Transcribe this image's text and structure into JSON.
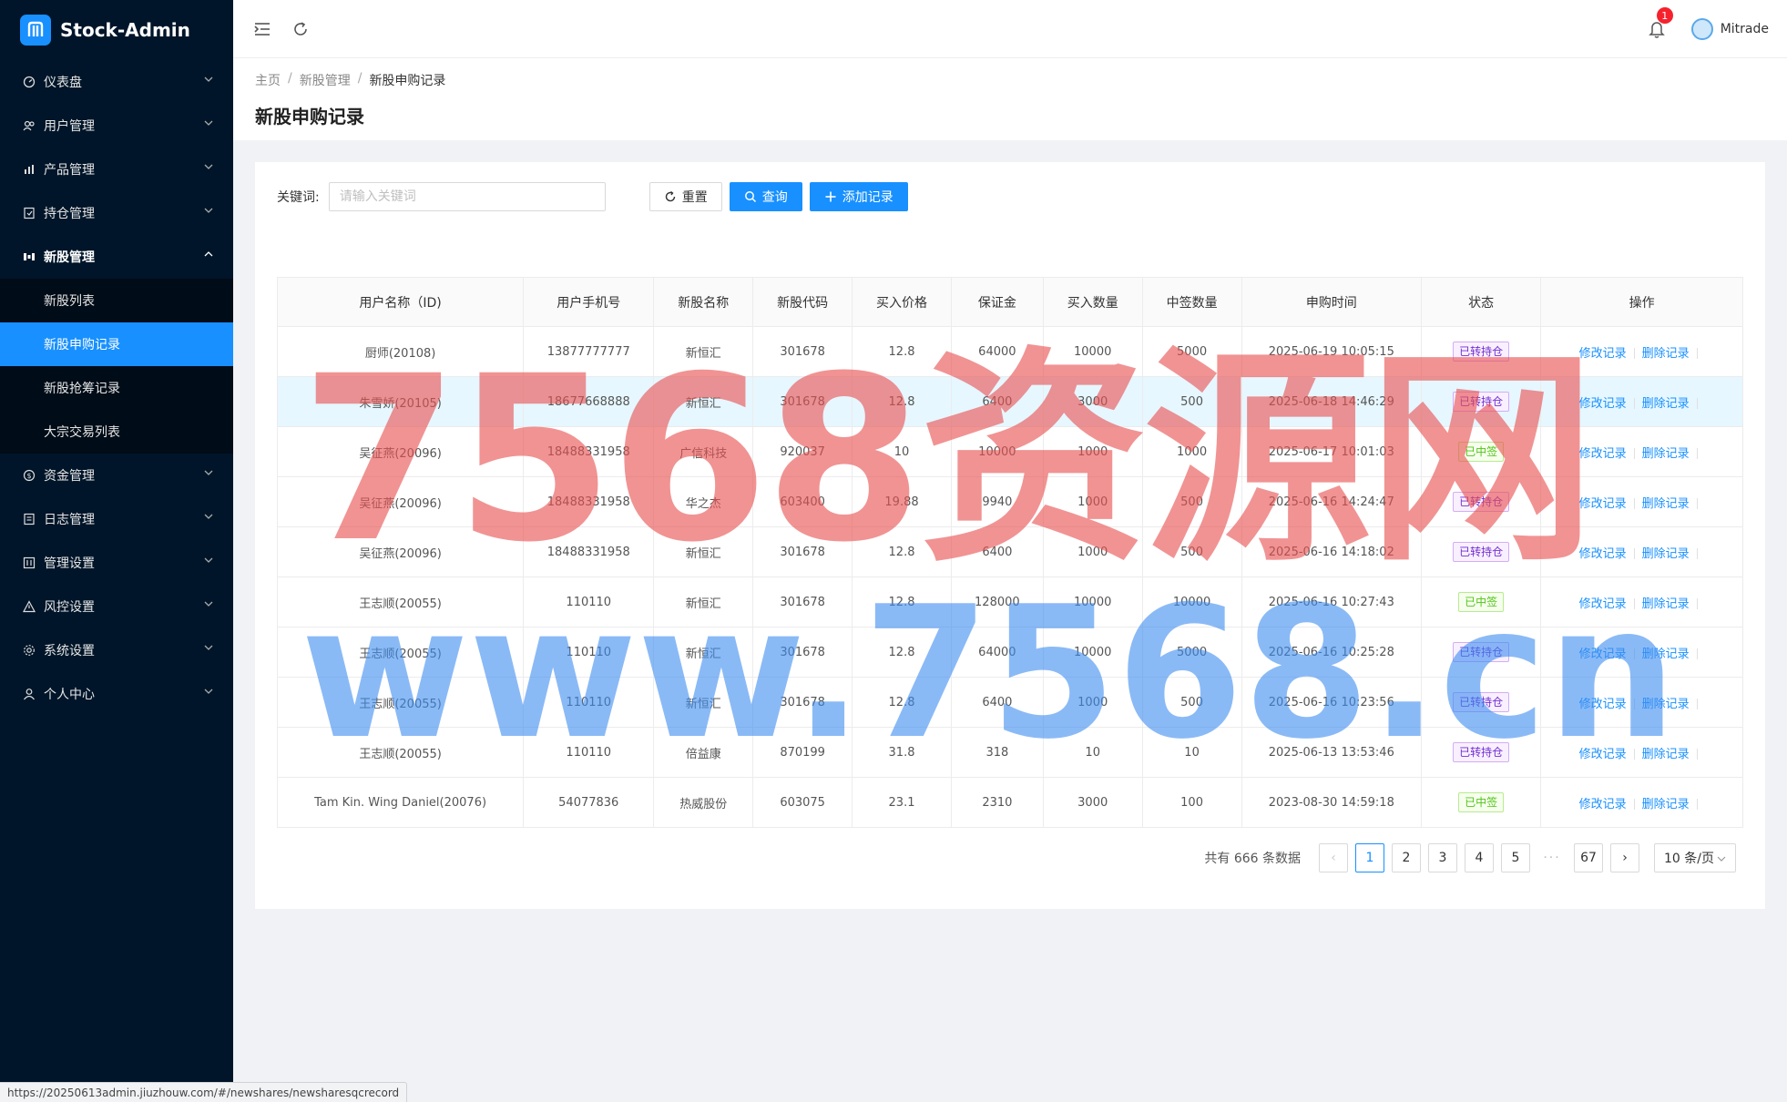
{
  "app": {
    "title": "Stock-Admin"
  },
  "sidebar": {
    "items": [
      {
        "label": "仪表盘",
        "icon": "dashboard-icon"
      },
      {
        "label": "用户管理",
        "icon": "users-icon"
      },
      {
        "label": "产品管理",
        "icon": "bar-chart-icon"
      },
      {
        "label": "持仓管理",
        "icon": "position-icon"
      },
      {
        "label": "新股管理",
        "icon": "ipo-icon",
        "open": true,
        "children": [
          "新股列表",
          "新股申购记录",
          "新股抢筹记录",
          "大宗交易列表"
        ]
      },
      {
        "label": "资金管理",
        "icon": "money-icon"
      },
      {
        "label": "日志管理",
        "icon": "log-icon"
      },
      {
        "label": "管理设置",
        "icon": "admin-settings-icon"
      },
      {
        "label": "风控设置",
        "icon": "warning-icon"
      },
      {
        "label": "系统设置",
        "icon": "gear-icon"
      },
      {
        "label": "个人中心",
        "icon": "user-icon"
      }
    ],
    "active_sub": "新股申购记录"
  },
  "header": {
    "notification_count": "1",
    "username": "Mitrade"
  },
  "breadcrumb": [
    "主页",
    "新股管理",
    "新股申购记录"
  ],
  "page_title": "新股申购记录",
  "filter": {
    "keyword_label": "关键词:",
    "keyword_placeholder": "请输入关键词",
    "reset_label": "重置",
    "query_label": "查询",
    "add_label": "添加记录"
  },
  "table": {
    "columns": [
      "用户名称（ID)",
      "用户手机号",
      "新股名称",
      "新股代码",
      "买入价格",
      "保证金",
      "买入数量",
      "中签数量",
      "申购时间",
      "状态",
      "操作"
    ],
    "rows": [
      [
        "厨师(20108)",
        "13877777777",
        "新恒汇",
        "301678",
        "12.8",
        "64000",
        "10000",
        "5000",
        "2025-06-19 10:05:15",
        "已转持仓"
      ],
      [
        "朱雪娇(20105)",
        "18677668888",
        "新恒汇",
        "301678",
        "12.8",
        "6400",
        "3000",
        "500",
        "2025-06-18 14:46:29",
        "已转持仓"
      ],
      [
        "吴征燕(20096)",
        "18488331958",
        "广信科技",
        "920037",
        "10",
        "10000",
        "1000",
        "1000",
        "2025-06-17 10:01:03",
        "已中签"
      ],
      [
        "吴征燕(20096)",
        "18488331958",
        "华之杰",
        "603400",
        "19.88",
        "9940",
        "1000",
        "500",
        "2025-06-16 14:24:47",
        "已转持仓"
      ],
      [
        "吴征燕(20096)",
        "18488331958",
        "新恒汇",
        "301678",
        "12.8",
        "6400",
        "1000",
        "500",
        "2025-06-16 14:18:02",
        "已转持仓"
      ],
      [
        "王志顺(20055)",
        "110110",
        "新恒汇",
        "301678",
        "12.8",
        "128000",
        "10000",
        "10000",
        "2025-06-16 10:27:43",
        "已中签"
      ],
      [
        "王志顺(20055)",
        "110110",
        "新恒汇",
        "301678",
        "12.8",
        "64000",
        "10000",
        "5000",
        "2025-06-16 10:25:28",
        "已转持仓"
      ],
      [
        "王志顺(20055)",
        "110110",
        "新恒汇",
        "301678",
        "12.8",
        "6400",
        "1000",
        "500",
        "2025-06-16 10:23:56",
        "已转持仓"
      ],
      [
        "王志顺(20055)",
        "110110",
        "倍益康",
        "870199",
        "31.8",
        "318",
        "10",
        "10",
        "2025-06-13 13:53:46",
        "已转持仓"
      ],
      [
        "Tam Kin. Wing Daniel(20076)",
        "54077836",
        "热威股份",
        "603075",
        "23.1",
        "2310",
        "3000",
        "100",
        "2023-08-30 14:59:18",
        "已中签"
      ]
    ],
    "highlight_row": 1,
    "edit_label": "修改记录",
    "delete_label": "删除记录"
  },
  "status_colors": {
    "已转持仓": "#722ed1",
    "已中签": "#52c41a"
  },
  "pagination": {
    "total_text": "共有 666 条数据",
    "pages": [
      "1",
      "2",
      "3",
      "4",
      "5"
    ],
    "ellipsis": "···",
    "last_page": "67",
    "current": "1",
    "page_size": "10 条/页"
  },
  "watermark": {
    "line1": "7568资源网",
    "line2": "www.7568.cn"
  },
  "statusbar": {
    "url": "https://20250613admin.jiuzhouw.com/#/newshares/newsharesqcrecord"
  },
  "colors": {
    "sidebar_bg": "#001529",
    "accent": "#1890ff"
  }
}
